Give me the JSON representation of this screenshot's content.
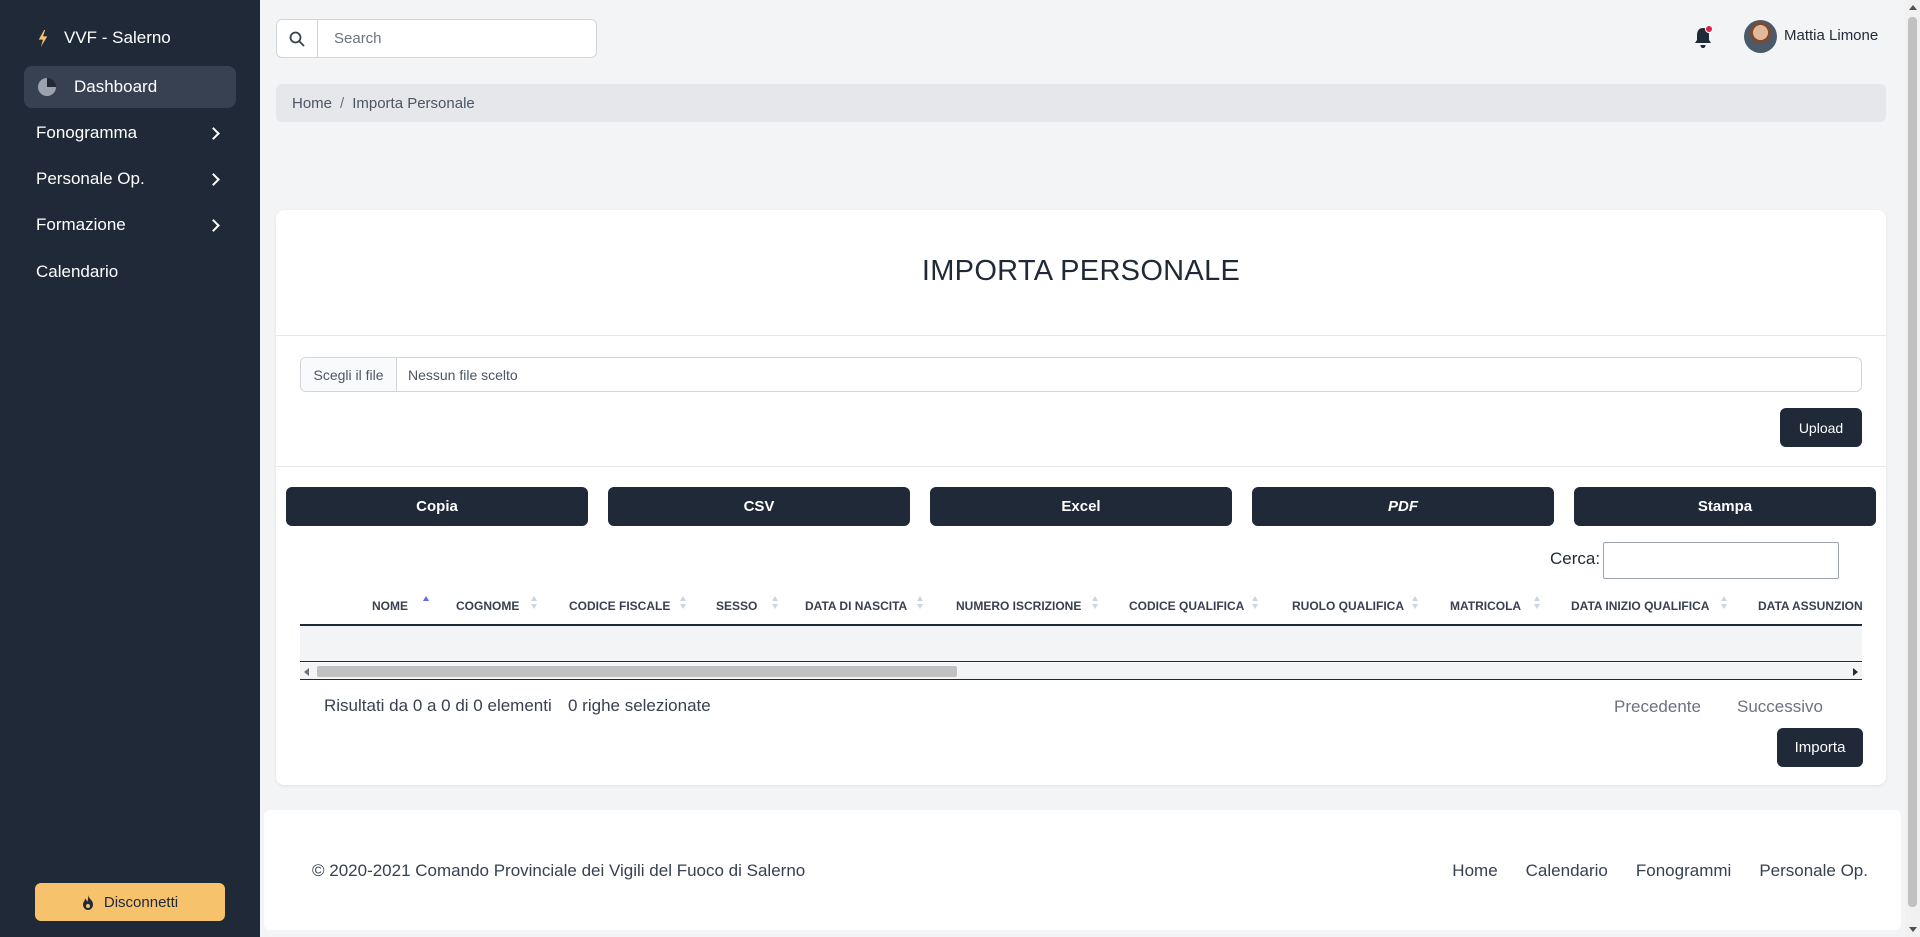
{
  "sidebar": {
    "brand": "VVF - Salerno",
    "brand_icon": "bolt-icon",
    "active_item": {
      "label": "Dashboard",
      "icon": "pie-chart-icon"
    },
    "items": [
      {
        "label": "Fonogramma",
        "has_submenu": true
      },
      {
        "label": "Personale Op.",
        "has_submenu": true
      },
      {
        "label": "Formazione",
        "has_submenu": true
      },
      {
        "label": "Calendario",
        "has_submenu": false
      }
    ],
    "logout_label": "Disconnetti"
  },
  "topbar": {
    "search_placeholder": "Search",
    "user_name": "Mattia Limone",
    "notification_dot_color": "#e11d48"
  },
  "breadcrumb": {
    "home": "Home",
    "current": "Importa Personale"
  },
  "card": {
    "title": "IMPORTA PERSONALE",
    "file_button": "Scegli il file",
    "file_status": "Nessun file scelto",
    "upload_label": "Upload",
    "export_buttons": [
      "Copia",
      "CSV",
      "Excel",
      "PDF",
      "Stampa"
    ],
    "search_label": "Cerca:",
    "columns": [
      "NOME",
      "COGNOME",
      "CODICE FISCALE",
      "SESSO",
      "DATA DI NASCITA",
      "NUMERO ISCRIZIONE",
      "CODICE QUALIFICA",
      "RUOLO QUALIFICA",
      "MATRICOLA",
      "DATA INIZIO QUALIFICA",
      "DATA ASSUNZIONE"
    ],
    "sorted_column": "NOME",
    "rows": [],
    "info": "Risultati da 0 a 0 di 0 elementi",
    "selected_info": "0 righe selezionate",
    "prev_label": "Precedente",
    "next_label": "Successivo",
    "importa_label": "Importa"
  },
  "footer": {
    "copyright": "© 2020-2021 Comando Provinciale dei Vigili del Fuoco di Salerno",
    "links": [
      "Home",
      "Calendario",
      "Fonogrammi",
      "Personale Op."
    ]
  },
  "colors": {
    "sidebar_bg": "#1f2937",
    "accent_yellow": "#f6c26b",
    "button_dark": "#1f2937",
    "sort_active": "#6366f1"
  }
}
